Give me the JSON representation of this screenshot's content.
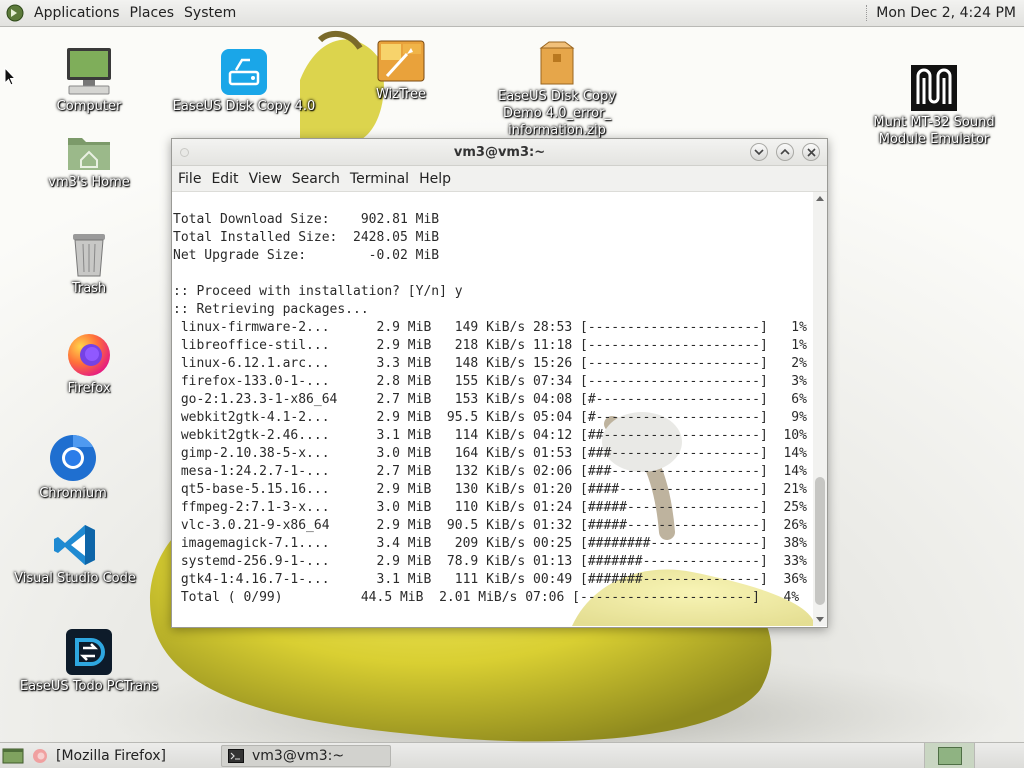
{
  "top_panel": {
    "menus": [
      "Applications",
      "Places",
      "System"
    ],
    "clock": "Mon Dec  2,  4:24 PM"
  },
  "desktop": {
    "icons": [
      {
        "label": "Computer",
        "icon": "computer-icon"
      },
      {
        "label": "vm3's Home",
        "icon": "home-folder-icon"
      },
      {
        "label": "Trash",
        "icon": "trash-icon"
      },
      {
        "label": "Firefox",
        "icon": "firefox-icon"
      },
      {
        "label": "Chromium",
        "icon": "chromium-icon"
      },
      {
        "label": "Visual Studio Code",
        "icon": "vscode-icon"
      },
      {
        "label": "EaseUS Todo PCTrans",
        "icon": "easeus-pctrans-icon"
      },
      {
        "label": "EaseUS Disk Copy 4.0",
        "icon": "easeus-diskcopy-icon"
      },
      {
        "label": "WizTree",
        "icon": "wiztree-icon"
      },
      {
        "label": "EaseUS Disk Copy Demo 4.0_error_ information.zip",
        "icon": "zip-archive-icon"
      },
      {
        "label": "Munt MT-32 Sound Module Emulator",
        "icon": "munt-icon"
      }
    ]
  },
  "terminal": {
    "title": "vm3@vm3:~",
    "menus": [
      "File",
      "Edit",
      "View",
      "Search",
      "Terminal",
      "Help"
    ],
    "lines": [
      "Total Download Size:    902.81 MiB",
      "Total Installed Size:  2428.05 MiB",
      "Net Upgrade Size:        -0.02 MiB",
      "",
      ":: Proceed with installation? [Y/n] y",
      ":: Retrieving packages...",
      " linux-firmware-2...      2.9 MiB   149 KiB/s 28:53 [----------------------]   1%",
      " libreoffice-stil...      2.9 MiB   218 KiB/s 11:18 [----------------------]   1%",
      " linux-6.12.1.arc...      3.3 MiB   148 KiB/s 15:26 [----------------------]   2%",
      " firefox-133.0-1-...      2.8 MiB   155 KiB/s 07:34 [----------------------]   3%",
      " go-2:1.23.3-1-x86_64     2.7 MiB   153 KiB/s 04:08 [#---------------------]   6%",
      " webkit2gtk-4.1-2...      2.9 MiB  95.5 KiB/s 05:04 [#---------------------]   9%",
      " webkit2gtk-2.46....      3.1 MiB   114 KiB/s 04:12 [##--------------------]  10%",
      " gimp-2.10.38-5-x...      3.0 MiB   164 KiB/s 01:53 [###-------------------]  14%",
      " mesa-1:24.2.7-1-...      2.7 MiB   132 KiB/s 02:06 [###-------------------]  14%",
      " qt5-base-5.15.16...      2.9 MiB   130 KiB/s 01:20 [####------------------]  21%",
      " ffmpeg-2:7.1-3-x...      3.0 MiB   110 KiB/s 01:24 [#####-----------------]  25%",
      " vlc-3.0.21-9-x86_64      2.9 MiB  90.5 KiB/s 01:32 [#####-----------------]  26%",
      " imagemagick-7.1....      3.4 MiB   209 KiB/s 00:25 [########--------------]  38%",
      " systemd-256.9-1-...      2.9 MiB  78.9 KiB/s 01:13 [#######---------------]  33%",
      " gtk4-1:4.16.7-1-...      3.1 MiB   111 KiB/s 00:49 [#######---------------]  36%",
      " Total ( 0/99)          44.5 MiB  2.01 MiB/s 07:06 [----------------------]   4%"
    ]
  },
  "taskbar": {
    "tasks": [
      {
        "label": "[Mozilla Firefox]",
        "icon": "firefox-small-icon",
        "active": false
      },
      {
        "label": "vm3@vm3:~",
        "icon": "terminal-small-icon",
        "active": true
      }
    ]
  },
  "colors": {
    "panel_bg": "#e6e6e3",
    "desktop_bg": "#fbfbf8",
    "pear_yellow": "#e3d63b",
    "terminal_text": "#2a2a2a"
  }
}
